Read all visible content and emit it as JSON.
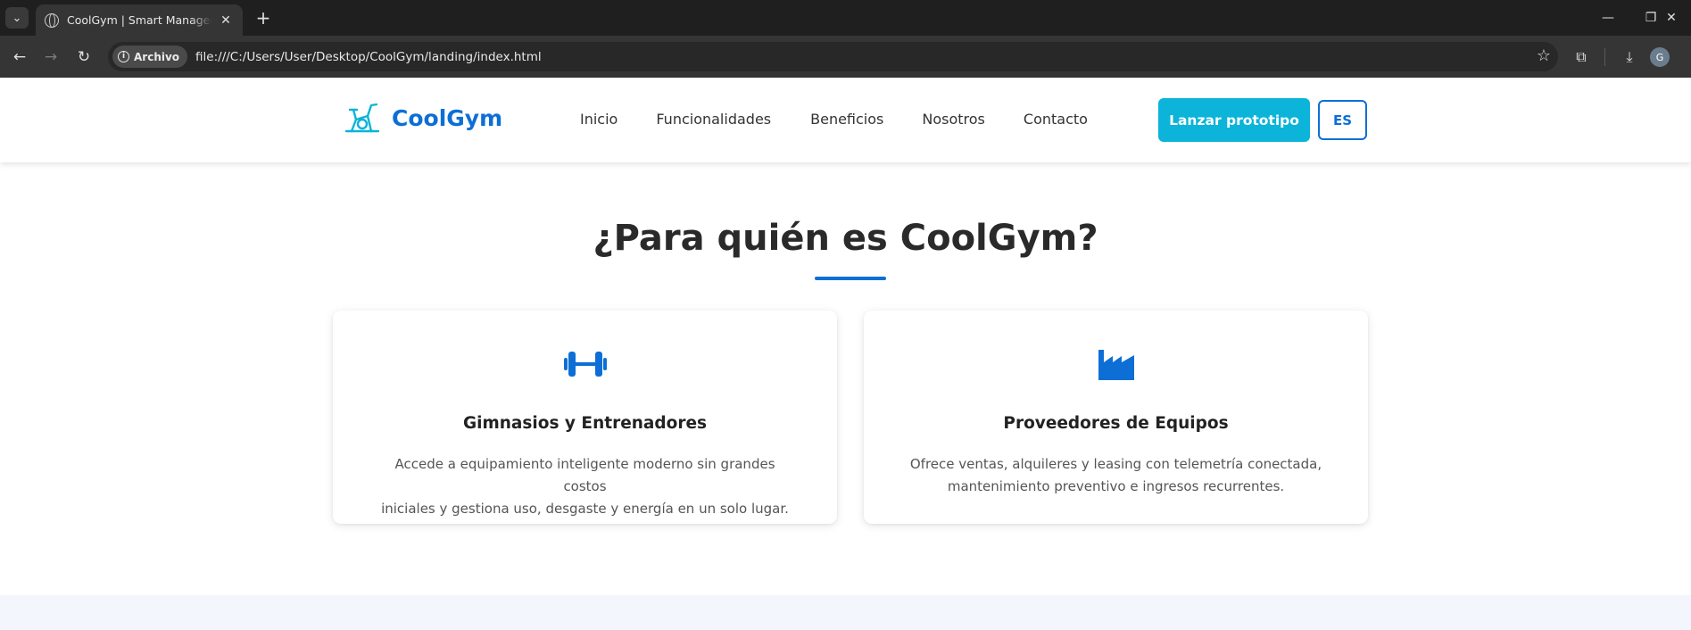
{
  "browser": {
    "tab_title": "CoolGym | Smart Management",
    "tab_close": "✕",
    "new_tab": "+",
    "site_chip": "Archivo",
    "url": "file:///C:/Users/User/Desktop/CoolGym/landing/index.html",
    "profile_initial": "G"
  },
  "header": {
    "brand_name": "CoolGym",
    "nav": [
      "Inicio",
      "Funcionalidades",
      "Beneficios",
      "Nosotros",
      "Contacto"
    ],
    "cta_label": "Lanzar prototipo",
    "lang_label": "ES"
  },
  "audience": {
    "title": "¿Para quién es CoolGym?",
    "cards": [
      {
        "icon": "dumbbell-icon",
        "title": "Gimnasios y Entrenadores",
        "text_lines": [
          "Accede a equipamiento inteligente moderno sin grandes costos",
          "iniciales y gestiona uso, desgaste y energía en un solo lugar."
        ]
      },
      {
        "icon": "factory-icon",
        "title": "Proveedores de Equipos",
        "text_lines": [
          "Ofrece ventas, alquileres y leasing con telemetría conectada,",
          "mantenimiento preventivo e ingresos recurrentes."
        ]
      }
    ]
  },
  "colors": {
    "brand_blue": "#0d6fd6",
    "cta_cyan": "#0bb4d8",
    "browser_dark": "#1f1f1f"
  }
}
